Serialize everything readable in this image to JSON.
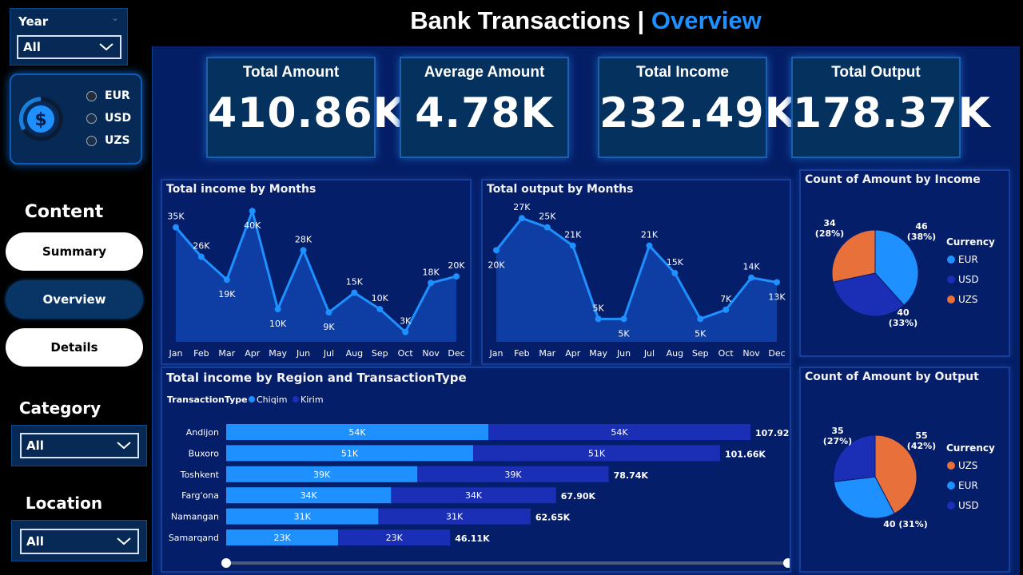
{
  "title": {
    "main": "Bank Transactions",
    "sep": "|",
    "accent": "Overview"
  },
  "sidebar": {
    "year": {
      "label": "Year",
      "value": "All"
    },
    "currency": {
      "options": [
        "EUR",
        "USD",
        "UZS"
      ],
      "selected": "EUR",
      "icon": "dollar-coin-icon"
    },
    "content_heading": "Content",
    "nav": [
      "Summary",
      "Overview",
      "Details"
    ],
    "category": {
      "label": "Category",
      "value": "All"
    },
    "location": {
      "label": "Location",
      "value": "All"
    }
  },
  "kpis": [
    {
      "label": "Total Amount",
      "value": "410.86K"
    },
    {
      "label": "Average Amount",
      "value": "4.78K"
    },
    {
      "label": "Total Income",
      "value": "232.49K"
    },
    {
      "label": "Total Output",
      "value": "178.37K"
    }
  ],
  "colors": {
    "blue": "#1e90ff",
    "navy": "#1a2fb5",
    "orange": "#e8703a",
    "accent": "#1e90ff"
  },
  "chart_data": [
    {
      "type": "area",
      "title": "Total income by Months",
      "categories": [
        "Jan",
        "Feb",
        "Mar",
        "Apr",
        "May",
        "Jun",
        "Jul",
        "Aug",
        "Sep",
        "Oct",
        "Nov",
        "Dec"
      ],
      "values": [
        35,
        26,
        19,
        40,
        10,
        28,
        9,
        15,
        10,
        3,
        18,
        20
      ],
      "labels": [
        "35K",
        "26K",
        "19K",
        "40K",
        "10K",
        "28K",
        "9K",
        "15K",
        "10K",
        "3K",
        "18K",
        "20K"
      ],
      "ylim": [
        0,
        42
      ]
    },
    {
      "type": "area",
      "title": "Total output by Months",
      "categories": [
        "Jan",
        "Feb",
        "Mar",
        "Apr",
        "May",
        "Jun",
        "Jul",
        "Aug",
        "Sep",
        "Oct",
        "Nov",
        "Dec"
      ],
      "values": [
        20,
        27,
        25,
        21,
        5,
        5,
        21,
        15,
        5,
        7,
        14,
        13
      ],
      "labels": [
        "20K",
        "27K",
        "25K",
        "21K",
        "5K",
        "5K",
        "21K",
        "15K",
        "5K",
        "7K",
        "14K",
        "13K"
      ],
      "ylim": [
        0,
        30
      ]
    },
    {
      "type": "pie",
      "title": "Count of Amount by Income",
      "legend_title": "Currency",
      "legend": [
        "EUR",
        "USD",
        "UZS"
      ],
      "slices": [
        {
          "name": "EUR",
          "value": 46,
          "label": "46",
          "pct": "(38%)"
        },
        {
          "name": "USD",
          "value": 40,
          "label": "40",
          "pct": "(33%)"
        },
        {
          "name": "UZS",
          "value": 34,
          "label": "34",
          "pct": "(28%)"
        }
      ]
    },
    {
      "type": "pie",
      "title": "Count of Amount by Output",
      "legend_title": "Currency",
      "legend": [
        "UZS",
        "EUR",
        "USD"
      ],
      "slices": [
        {
          "name": "UZS",
          "value": 55,
          "label": "55",
          "pct": "(42%)"
        },
        {
          "name": "EUR",
          "value": 40,
          "label": "40 (31%)",
          "pct": ""
        },
        {
          "name": "USD",
          "value": 35,
          "label": "35",
          "pct": "(27%)"
        }
      ]
    },
    {
      "type": "bar",
      "orientation": "horizontal-stacked",
      "title": "Total income by Region and TransactionType",
      "legend_title": "TransactionType",
      "categories": [
        "Andijon",
        "Buxoro",
        "Toshkent",
        "Farg'ona",
        "Namangan",
        "Samarqand"
      ],
      "series": [
        {
          "name": "Chiqim",
          "values": [
            54,
            51,
            39,
            34,
            31,
            23
          ],
          "labels": [
            "54K",
            "51K",
            "39K",
            "34K",
            "31K",
            "23K"
          ]
        },
        {
          "name": "Kirim",
          "values": [
            54,
            51,
            39,
            34,
            31,
            23
          ],
          "labels": [
            "54K",
            "51K",
            "39K",
            "34K",
            "31K",
            "23K"
          ]
        }
      ],
      "totals": [
        "107.92K",
        "101.66K",
        "78.74K",
        "67.90K",
        "62.65K",
        "46.11K"
      ],
      "total_values": [
        107.92,
        101.66,
        78.74,
        67.9,
        62.65,
        46.11
      ]
    }
  ]
}
